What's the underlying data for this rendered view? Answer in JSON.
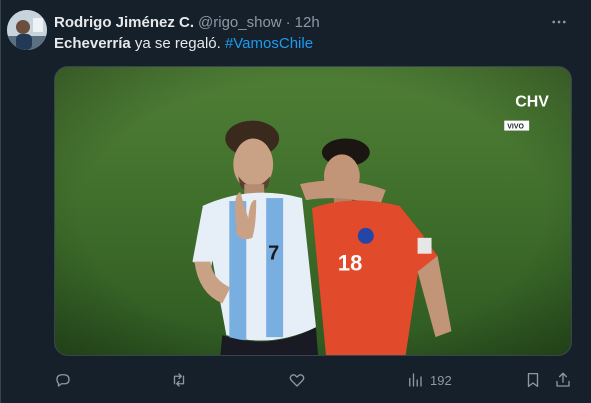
{
  "tweet": {
    "display_name": "Rodrigo Jiménez C.",
    "handle": "@rigo_show",
    "separator": "·",
    "time": "12h",
    "more_icon": "more-horizontal-icon",
    "text_bold": "Echeverría",
    "text_plain": " ya se regaló. ",
    "hashtag": "#VamosChile"
  },
  "media": {
    "broadcast_logo_text": "CHV",
    "broadcast_live_label": "VIVO",
    "player_left_number": "7",
    "player_right_number": "18"
  },
  "actions": {
    "reply_icon": "reply-icon",
    "retweet_icon": "retweet-icon",
    "like_icon": "heart-icon",
    "views_icon": "views-chart-icon",
    "views_count": "192",
    "bookmark_icon": "bookmark-icon",
    "share_icon": "share-icon"
  },
  "colors": {
    "background": "#15202b",
    "text": "#e7e9ea",
    "secondary": "#8b98a5",
    "accent": "#1d9bf0"
  }
}
